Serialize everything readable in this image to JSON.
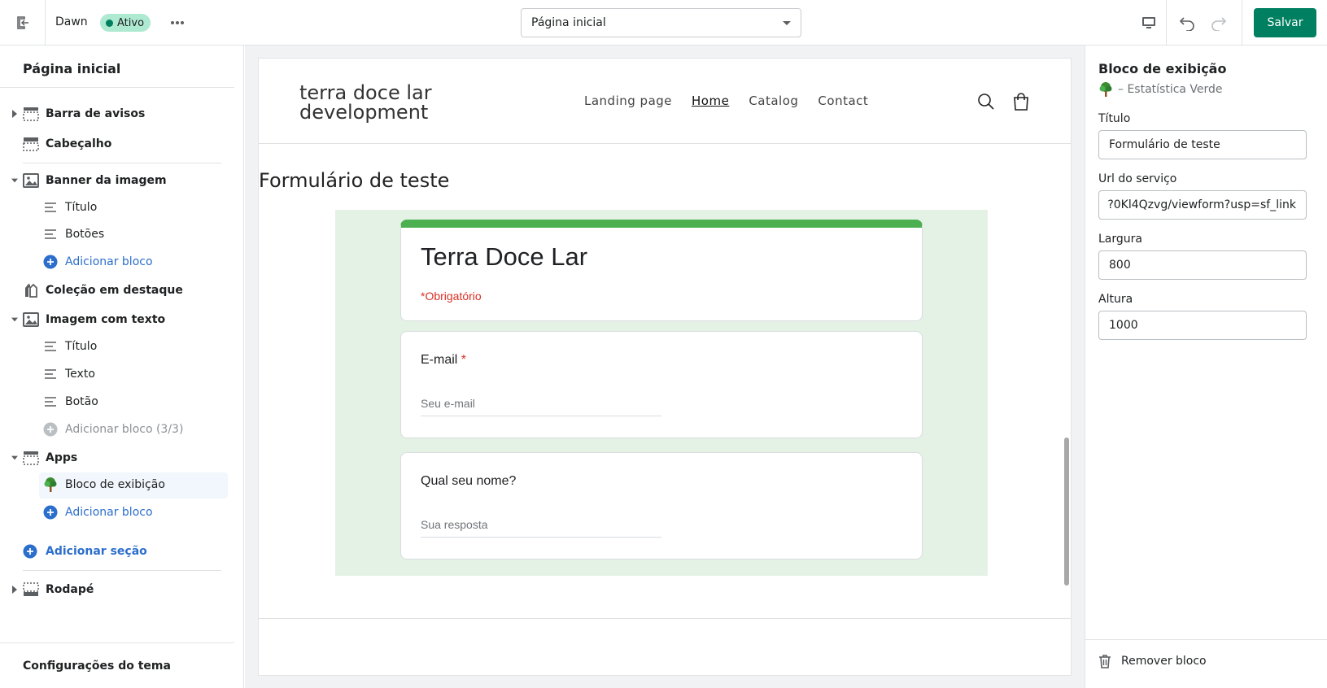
{
  "topbar": {
    "theme_name": "Dawn",
    "status_badge": "Ativo",
    "page_select": "Página inicial",
    "save_label": "Salvar"
  },
  "sidebar": {
    "title": "Página inicial",
    "sections": [
      {
        "label": "Barra de avisos",
        "icon": "announcement-bar-icon"
      },
      {
        "label": "Cabeçalho",
        "icon": "header-icon"
      },
      {
        "label": "Banner da imagem",
        "icon": "image-icon",
        "blocks": [
          "Título",
          "Botões"
        ],
        "add_block": "Adicionar bloco"
      },
      {
        "label": "Coleção em destaque",
        "icon": "collection-icon"
      },
      {
        "label": "Imagem com texto",
        "icon": "image-icon",
        "blocks": [
          "Título",
          "Texto",
          "Botão"
        ],
        "add_block": "Adicionar bloco (3/3)"
      },
      {
        "label": "Apps",
        "icon": "apps-icon",
        "blocks": [
          "Bloco de exibição"
        ],
        "add_block": "Adicionar bloco"
      },
      {
        "label": "Rodapé",
        "icon": "footer-icon"
      }
    ],
    "add_section": "Adicionar seção",
    "theme_settings": "Configurações do tema"
  },
  "preview": {
    "store_title": "terra doce lar development",
    "nav": [
      "Landing page",
      "Home",
      "Catalog",
      "Contact"
    ],
    "form_heading": "Formulário de teste",
    "gform": {
      "title": "Terra Doce Lar",
      "required_note": "*Obrigatório",
      "questions": [
        {
          "label": "E-mail",
          "required_mark": "*",
          "placeholder": "Seu e-mail"
        },
        {
          "label": "Qual seu nome?",
          "placeholder": "Sua resposta"
        }
      ]
    }
  },
  "rpanel": {
    "title": "Bloco de exibição",
    "subtitle": "– Estatística Verde",
    "fields": [
      {
        "label": "Título",
        "value": "Formulário de teste"
      },
      {
        "label": "Url do serviço",
        "value": "?0Kl4Qzvg/viewform?usp=sf_link"
      },
      {
        "label": "Largura",
        "value": "800"
      },
      {
        "label": "Altura",
        "value": "1000"
      }
    ],
    "remove_label": "Remover bloco"
  },
  "colors": {
    "accent": "#008060",
    "link": "#2c6ecb",
    "badge": "#aee9d1",
    "gform_accent": "#4caf50",
    "gform_bg": "#e4f2e5"
  }
}
